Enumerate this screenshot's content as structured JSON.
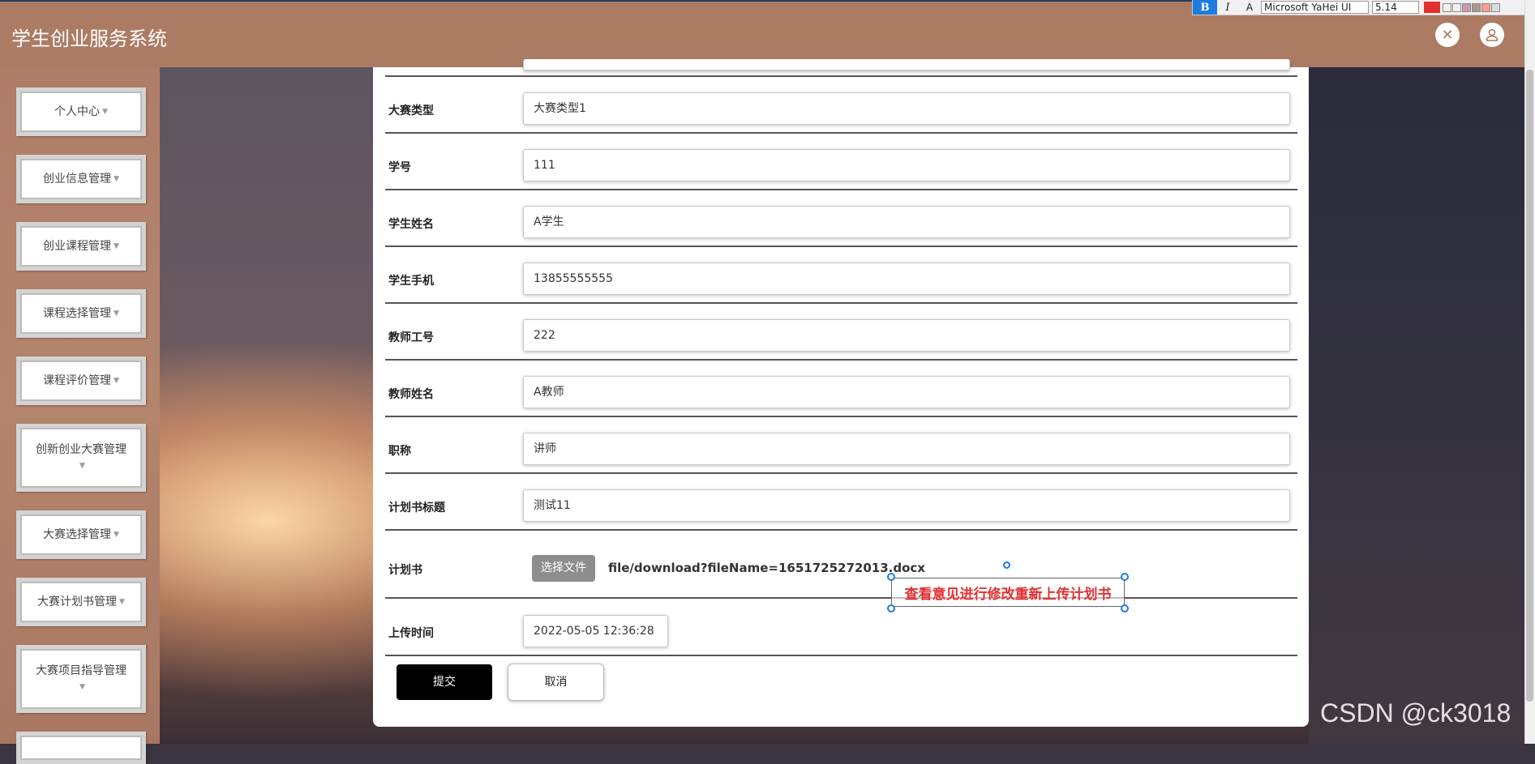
{
  "header": {
    "title": "学生创业服务系统",
    "fullscreen_icon": "fullscreen-exit-icon",
    "user_icon": "user-icon"
  },
  "toolbar": {
    "bold": "B",
    "italic": "I",
    "clear_format": "A",
    "font_family": "Microsoft YaHei UI",
    "font_size": "5.14",
    "text_color": "#e53030"
  },
  "sidebar": {
    "items": [
      {
        "label": "个人中心"
      },
      {
        "label": "创业信息管理"
      },
      {
        "label": "创业课程管理"
      },
      {
        "label": "课程选择管理"
      },
      {
        "label": "课程评价管理"
      },
      {
        "label": "创新创业大赛管理"
      },
      {
        "label": "大赛选择管理"
      },
      {
        "label": "大赛计划书管理"
      },
      {
        "label": "大赛项目指导管理"
      }
    ]
  },
  "form": {
    "fields": [
      {
        "label": "大赛类型",
        "value": "大赛类型1"
      },
      {
        "label": "学号",
        "value": "111"
      },
      {
        "label": "学生姓名",
        "value": "A学生"
      },
      {
        "label": "学生手机",
        "value": "13855555555"
      },
      {
        "label": "教师工号",
        "value": "222"
      },
      {
        "label": "教师姓名",
        "value": "A教师"
      },
      {
        "label": "职称",
        "value": "讲师"
      },
      {
        "label": "计划书标题",
        "value": "测试11"
      }
    ],
    "plan": {
      "label": "计划书",
      "choose_file": "选择文件",
      "file_name": "file/download?fileName=1651725272013.docx"
    },
    "upload_time": {
      "label": "上传时间",
      "value": "2022-05-05 12:36:28"
    },
    "submit_label": "提交",
    "cancel_label": "取消"
  },
  "annotation": {
    "text": "查看意见进行修改重新上传计划书",
    "color": "#e53030"
  },
  "watermark": "CSDN @ck3018",
  "colors": {
    "header": "#ac7b64",
    "submit": "#000000"
  }
}
